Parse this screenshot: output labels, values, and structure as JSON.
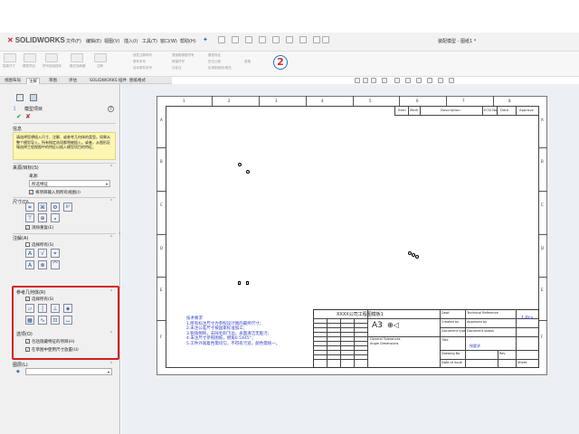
{
  "app": {
    "logo_brand": "SOLIDWORKS",
    "doc_title": "装配模型 - 图纸1 *"
  },
  "menu": [
    "文件(F)",
    "编辑(E)",
    "视图(V)",
    "插入(I)",
    "工具(T)",
    "窗口(W)",
    "帮助(H)"
  ],
  "badge": "2",
  "tabs": [
    "视图布局",
    "注解",
    "草图",
    "评估",
    "SOLIDWORKS 插件",
    "图纸格式"
  ],
  "ribbon_labels": [
    "智能尺寸",
    "模型项目",
    "拼写检验程序",
    "格式涂刷器",
    "注释",
    "线性注释阵列",
    "零件序号",
    "自动零件序号",
    "表面粗糙度符号",
    "焊接符号",
    "孔标注",
    "基准特征",
    "形位公差",
    "区域剖面线/填充",
    "表格"
  ],
  "panel": {
    "title": "模型项目",
    "help": "?",
    "info_head": "信息",
    "info_text": "请选择您想插入尺寸、注解、或参考几何体的类型。如果从整个模型导入，所有指定选项都将被插入。或者，从图形区域选择工程视图中的特征以插入模型项目的特征。",
    "source_head": "来源/目标(S)",
    "source_label": "来源:",
    "source_value": "所选特征",
    "import_all_label": "将项目输入到所有视图(I)",
    "dim_head": "尺寸(D)",
    "remove_dup_label": "消除重复(E)",
    "ann_head": "注解(A)",
    "select_all_ann": "选择所有(S)",
    "refgeo_head": "参考几何体(R)",
    "select_all_ref": "选择所有(S)",
    "options_head": "选项(O)",
    "opt1": "包括隐藏特征的项目(H)",
    "opt2": "在草图中使用尺寸放置(U)",
    "layer_head": "图层(L)"
  },
  "sheet": {
    "zones_top": [
      "1",
      "2",
      "3",
      "4",
      "5",
      "6",
      "7",
      "8"
    ],
    "zones_side": [
      "A",
      "B",
      "C",
      "D",
      "E",
      "F"
    ],
    "rev_headers": [
      "Item",
      "Mark",
      "Description",
      "ECN No",
      "Date",
      "Approve"
    ],
    "notes": [
      "技术要求",
      "1.所有标注尺寸为参照设计图的最终尺寸；",
      "2.未注公差尺寸按国家标准加工；",
      "3.锐角倒钝，去除毛刺飞边，表面清洁无脏污；",
      "4.未注尺寸参照图纸，倒角0.5X45°；",
      "5.工件外观着色需均匀，不得有污迹，颜色需统一。"
    ],
    "titleblock": {
      "company": "XXXX公司工程图模板1",
      "size": "A3",
      "scale": "1 Pcs",
      "material": "按要求",
      "labels": [
        "General Tolerances",
        "Angle Dimensions",
        "Dept",
        "Technical Reference",
        "Created by",
        "Approved by",
        "Document type",
        "Document status",
        "Title",
        "Drawing No",
        "Rev",
        "Date of issue",
        "Sheet"
      ]
    }
  },
  "colors": {
    "accent": "#1f6fd1",
    "highlight": "#d61d1d",
    "note_blue": "#2d3cc9",
    "info_yellow": "#fdf6b3"
  }
}
